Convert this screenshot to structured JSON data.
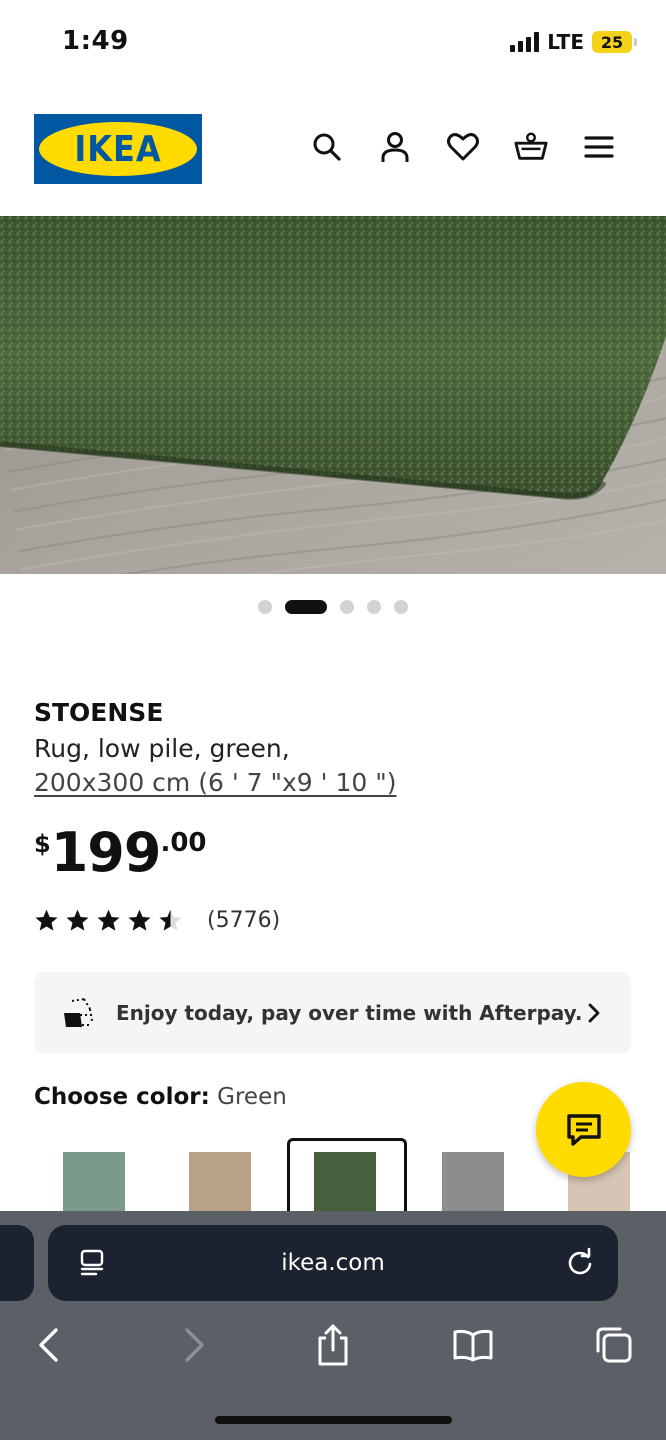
{
  "status_bar": {
    "time": "1:49",
    "network": "LTE",
    "battery": "25"
  },
  "header": {
    "logo_text": "IKEA",
    "icons": [
      "search-icon",
      "account-icon",
      "heart-icon",
      "cart-icon",
      "menu-icon"
    ]
  },
  "carousel": {
    "total": 5,
    "active_index": 1
  },
  "product": {
    "name": "STOENSE",
    "description": "Rug, low pile, green,",
    "size": "200x300 cm (6 ' 7 \"x9 ' 10 \")",
    "price": {
      "currency": "$",
      "integer": "199",
      "decimal": ".00"
    },
    "rating": 4.5,
    "review_count": "(5776)"
  },
  "afterpay": {
    "text": "Enjoy today, pay over time with Afterpay."
  },
  "color": {
    "label": "Choose color:",
    "selected": "Green",
    "swatches": [
      {
        "color": "#7a9a8c"
      },
      {
        "color": "#b8a287"
      },
      {
        "color": "#47613f",
        "selected": true
      },
      {
        "color": "#8c8d8e"
      },
      {
        "color": "#d6c4b4"
      }
    ]
  },
  "browser": {
    "url": "ikea.com"
  },
  "colors": {
    "ikea_blue": "#0058a3",
    "ikea_yellow": "#ffdb00"
  }
}
